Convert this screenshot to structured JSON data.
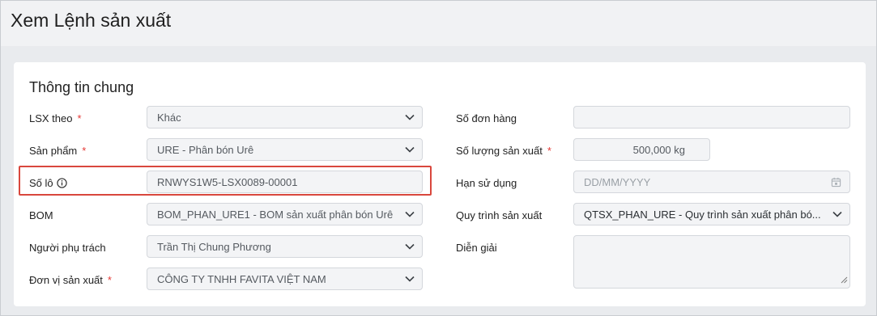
{
  "header": {
    "title": "Xem Lệnh sản xuất"
  },
  "section": {
    "title": "Thông tin chung"
  },
  "left": {
    "lsx_theo": {
      "label": "LSX theo",
      "required": "*",
      "value": "Khác"
    },
    "san_pham": {
      "label": "Sản phẩm",
      "required": "*",
      "value": "URE - Phân bón Urê"
    },
    "so_lo": {
      "label": "Số lô",
      "value": "RNWYS1W5-LSX0089-00001"
    },
    "bom": {
      "label": "BOM",
      "value": "BOM_PHAN_URE1 - BOM sản xuất phân bón Urê"
    },
    "nguoi_phu_trach": {
      "label": "Người phụ trách",
      "value": "Trần Thị Chung Phương"
    },
    "don_vi": {
      "label": "Đơn vị sản xuất",
      "required": "*",
      "value": "CÔNG TY TNHH FAVITA VIỆT NAM"
    }
  },
  "right": {
    "so_don_hang": {
      "label": "Số đơn hàng",
      "value": ""
    },
    "so_luong": {
      "label": "Số lượng sản xuất",
      "required": "*",
      "value": "500,000 kg"
    },
    "han_su_dung": {
      "label": "Hạn sử dụng",
      "placeholder": "DD/MM/YYYY"
    },
    "quy_trinh": {
      "label": "Quy trình sản xuất",
      "value": "QTSX_PHAN_URE - Quy trình sản xuất phân bó..."
    },
    "dien_giai": {
      "label": "Diễn giải",
      "value": ""
    }
  },
  "icons": {
    "dropdown": "chevron-down-icon",
    "info": "info-icon",
    "calendar": "calendar-icon",
    "resize": "resize-handle-icon"
  },
  "colors": {
    "highlight": "#d9473d",
    "required": "#e53935",
    "field_bg": "#f3f4f6"
  }
}
